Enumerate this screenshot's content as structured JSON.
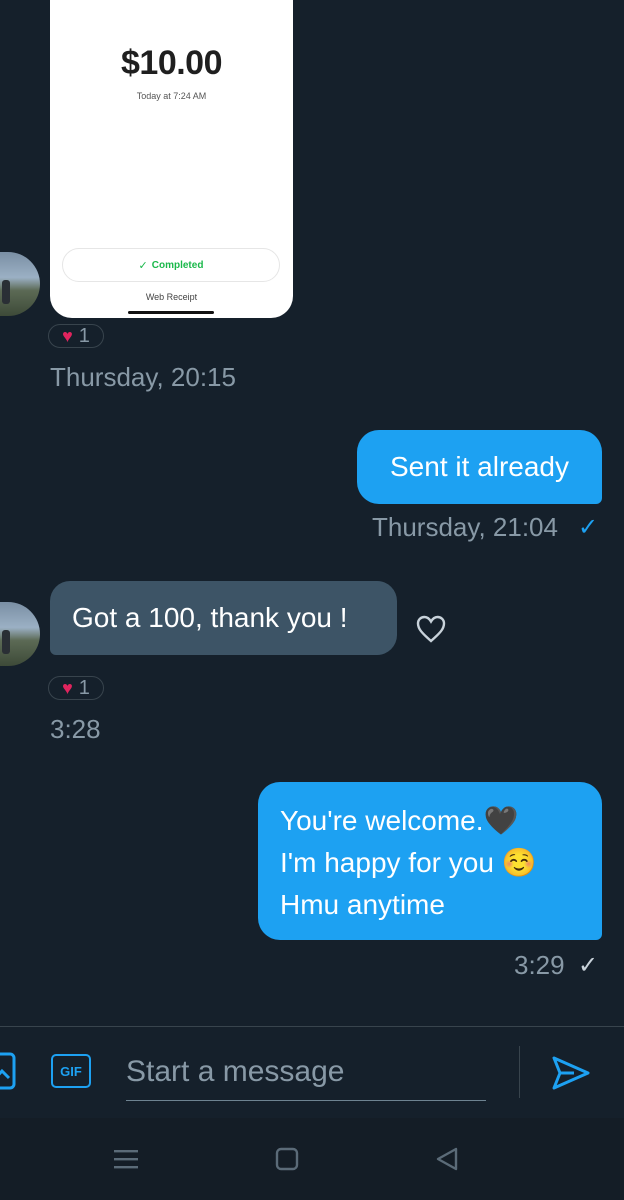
{
  "receipt": {
    "amount": "$10.00",
    "time": "Today at 7:24 AM",
    "status": "Completed",
    "web_receipt": "Web Receipt"
  },
  "messages": [
    {
      "reaction_count": "1",
      "timestamp": "Thursday, 20:15"
    },
    {
      "text": "Sent it already",
      "timestamp": "Thursday, 21:04"
    },
    {
      "text": "Got a 100, thank you !",
      "reaction_count": "1",
      "timestamp": "3:28"
    },
    {
      "lines": [
        "You're welcome.🖤",
        "I'm happy for you ☺️",
        "Hmu anytime"
      ],
      "timestamp": "3:29"
    }
  ],
  "composer": {
    "gif_label": "GIF",
    "placeholder": "Start a message"
  },
  "icons": {
    "image": "image-icon",
    "gif": "gif-icon",
    "send": "send-icon",
    "heart": "heart-icon",
    "check": "check-icon",
    "menu": "menu-icon",
    "home": "home-icon",
    "back": "back-icon"
  },
  "colors": {
    "background": "#15202b",
    "accent": "#1da1f2",
    "incoming_bubble": "#3d5466",
    "heart": "#e0245e",
    "completed": "#1ab84a"
  }
}
